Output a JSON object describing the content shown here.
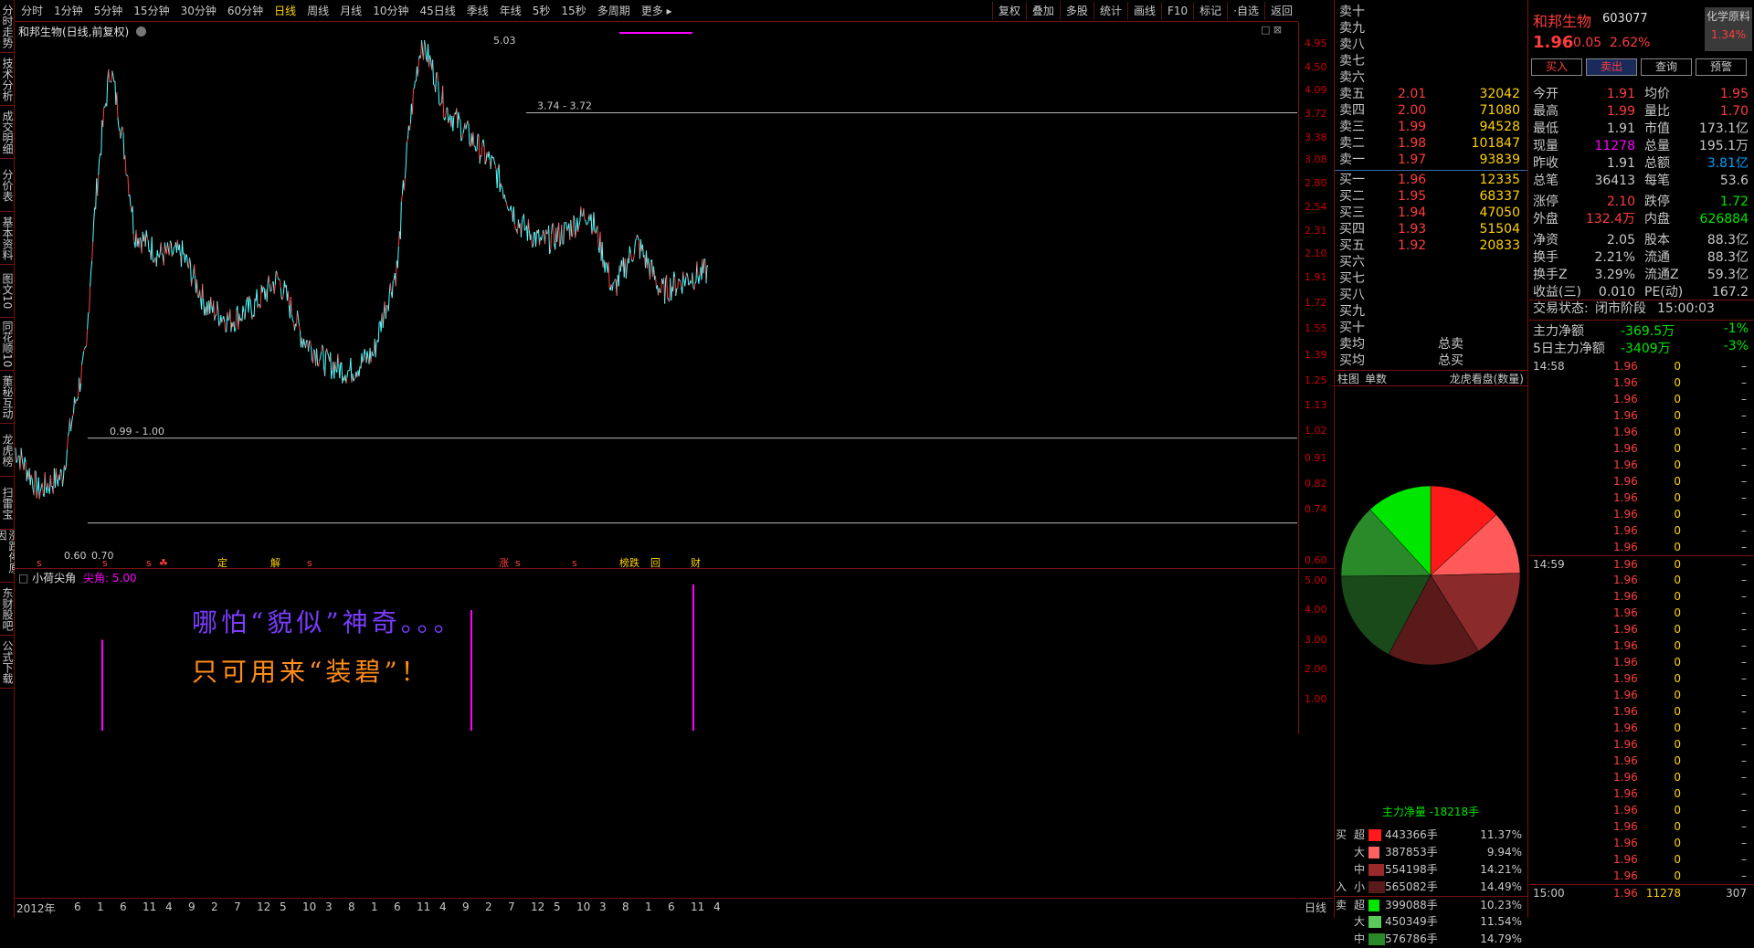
{
  "side_tabs": [
    "分时走势",
    "技术分析",
    "成交明细",
    "分价表",
    "基本资料",
    "图文10",
    "同花顺10",
    "董秘互动",
    "龙虎榜",
    "扫雷宝",
    "涨跌停原因",
    "东财股吧",
    "公式下载"
  ],
  "periods": [
    "分时",
    "1分钟",
    "5分钟",
    "15分钟",
    "30分钟",
    "60分钟",
    "日线",
    "周线",
    "月线",
    "10分钟",
    "45日线",
    "季线",
    "年线",
    "5秒",
    "15秒",
    "多周期",
    "更多 ▸"
  ],
  "active_period": "日线",
  "tools": [
    "复权",
    "叠加",
    "多股",
    "统计",
    "画线",
    "F10",
    "标记",
    "·自选",
    "返回"
  ],
  "chart_title": "和邦生物(日线,前复权)",
  "price_axis": [
    "4.95",
    "4.50",
    "4.09",
    "3.72",
    "3.38",
    "3.08",
    "2.80",
    "2.54",
    "2.31",
    "2.10",
    "1.91",
    "1.72",
    "1.55",
    "1.39",
    "1.25",
    "1.13",
    "1.02",
    "0.91",
    "0.82",
    "0.74",
    "0.60"
  ],
  "annotations": {
    "high": "5.03",
    "hline1": "3.74 - 3.72",
    "hline2": "0.99 - 1.00",
    "low": "0.60",
    "low2": "0.70"
  },
  "event_markers": [
    "s",
    "s",
    "s",
    "☘",
    "定",
    "解",
    "s",
    "涨",
    "s",
    "s",
    "榜跌",
    "回",
    "财"
  ],
  "indicator": {
    "name": "小荷尖角",
    "label": "尖角: 5.00",
    "axis": [
      "5.00",
      "4.00",
      "3.00",
      "2.00",
      "1.00"
    ]
  },
  "overlay_text": {
    "line1": "哪怕“貌似”神奇。。。",
    "line2": "只可用来“装碧”！"
  },
  "date_axis": [
    "2012年",
    "6",
    "1",
    "6",
    "11",
    "4",
    "9",
    "2",
    "7",
    "12",
    "5",
    "10",
    "3",
    "8",
    "1",
    "6",
    "11",
    "4",
    "9",
    "2",
    "7",
    "12",
    "5",
    "10",
    "3",
    "8",
    "1",
    "6",
    "11",
    "4"
  ],
  "period_label": "日线",
  "order_book": {
    "sells": [
      {
        "l": "卖十",
        "p": "",
        "v": ""
      },
      {
        "l": "卖九",
        "p": "",
        "v": ""
      },
      {
        "l": "卖八",
        "p": "",
        "v": ""
      },
      {
        "l": "卖七",
        "p": "",
        "v": ""
      },
      {
        "l": "卖六",
        "p": "",
        "v": ""
      },
      {
        "l": "卖五",
        "p": "2.01",
        "v": "32042"
      },
      {
        "l": "卖四",
        "p": "2.00",
        "v": "71080"
      },
      {
        "l": "卖三",
        "p": "1.99",
        "v": "94528"
      },
      {
        "l": "卖二",
        "p": "1.98",
        "v": "101847"
      },
      {
        "l": "卖一",
        "p": "1.97",
        "v": "93839"
      }
    ],
    "buys": [
      {
        "l": "买一",
        "p": "1.96",
        "v": "12335"
      },
      {
        "l": "买二",
        "p": "1.95",
        "v": "68337"
      },
      {
        "l": "买三",
        "p": "1.94",
        "v": "47050"
      },
      {
        "l": "买四",
        "p": "1.93",
        "v": "51504"
      },
      {
        "l": "买五",
        "p": "1.92",
        "v": "20833"
      },
      {
        "l": "买六",
        "p": "",
        "v": ""
      },
      {
        "l": "买七",
        "p": "",
        "v": ""
      },
      {
        "l": "买八",
        "p": "",
        "v": ""
      },
      {
        "l": "买九",
        "p": "",
        "v": ""
      },
      {
        "l": "买十",
        "p": "",
        "v": ""
      }
    ],
    "avg_sell": "卖均",
    "total_sell": "总卖",
    "avg_buy": "买均",
    "total_buy": "总买"
  },
  "flow_tabs": [
    "柱图",
    "单数",
    "龙虎看盘(数量)"
  ],
  "pie": {
    "values": [
      11.37,
      9.94,
      14.21,
      14.49,
      14.79,
      11.54,
      10.23
    ],
    "colors": [
      "#ff1a1a",
      "#ff5a5a",
      "#8b2a2a",
      "#5a1a1a",
      "#1a4a1a",
      "#2a8a2a",
      "#5ac85a",
      "#00e600"
    ]
  },
  "pie_values": {
    "buy": [
      11.37,
      9.94,
      14.21,
      14.49
    ],
    "sell": [
      10.23,
      11.54,
      14.79
    ]
  },
  "net_flow": "主力净量 -18218手",
  "flow_rows": [
    {
      "side": "买",
      "size": "超",
      "vol": "443366手",
      "pct": "11.37%",
      "color": "#ff1a1a",
      "frac": 0.77
    },
    {
      "side": "",
      "size": "大",
      "vol": "387853手",
      "pct": "9.94%",
      "color": "#ff6060",
      "frac": 0.67
    },
    {
      "side": "",
      "size": "中",
      "vol": "554198手",
      "pct": "14.21%",
      "color": "#9a2a2a",
      "frac": 0.96
    },
    {
      "side": "入",
      "size": "小",
      "vol": "565082手",
      "pct": "14.49%",
      "color": "#5a1a1a",
      "frac": 0.98
    },
    {
      "side": "卖",
      "size": "超",
      "vol": "399088手",
      "pct": "10.23%",
      "color": "#00e600",
      "frac": 0.69
    },
    {
      "side": "",
      "size": "大",
      "vol": "450349手",
      "pct": "11.54%",
      "color": "#5ac85a",
      "frac": 0.78
    },
    {
      "side": "",
      "size": "中",
      "vol": "576786手",
      "pct": "14.79%",
      "color": "#2a8a2a",
      "frac": 1.0
    }
  ],
  "quote": {
    "name": "和邦生物",
    "code": "603077",
    "sector": "化学原料",
    "sector_pct": "1.34%",
    "price": "1.96",
    "change": "0.05",
    "pct": "2.62%",
    "buttons": [
      "买入",
      "卖出",
      "查询",
      "预警"
    ],
    "rows": [
      [
        "今开",
        "1.91",
        "均价",
        "1.95"
      ],
      [
        "最高",
        "1.99",
        "量比",
        "1.70"
      ],
      [
        "最低",
        "1.91",
        "市值",
        "173.1亿"
      ],
      [
        "现量",
        "11278",
        "总量",
        "195.1万"
      ],
      [
        "昨收",
        "1.91",
        "总额",
        "3.81亿"
      ],
      [
        "总笔",
        "36413",
        "每笔",
        "53.6"
      ],
      [
        "涨停",
        "2.10",
        "跌停",
        "1.72"
      ],
      [
        "外盘",
        "132.4万",
        "内盘",
        "626884"
      ],
      [
        "净资",
        "2.05",
        "股本",
        "88.3亿"
      ],
      [
        "换手",
        "2.21%",
        "流通",
        "88.3亿"
      ],
      [
        "换手Z",
        "3.29%",
        "流通Z",
        "59.3亿"
      ],
      [
        "收益(三)",
        "0.010",
        "PE(动)",
        "167.2"
      ]
    ],
    "status_label": "交易状态:",
    "status": "闭市阶段",
    "time": "15:00:03",
    "main_net_label": "主力净额",
    "main_net": "-369.5万",
    "main_net_pct": "-1%",
    "main5_label": "5日主力净额",
    "main5": "-3409万",
    "main5_pct": "-3%"
  },
  "ticks": [
    {
      "t": "14:58",
      "p": "1.96",
      "v": "0",
      "d": "–"
    },
    {
      "t": "",
      "p": "1.96",
      "v": "0",
      "d": "–"
    },
    {
      "t": "",
      "p": "1.96",
      "v": "0",
      "d": "–"
    },
    {
      "t": "",
      "p": "1.96",
      "v": "0",
      "d": "–"
    },
    {
      "t": "",
      "p": "1.96",
      "v": "0",
      "d": "–"
    },
    {
      "t": "",
      "p": "1.96",
      "v": "0",
      "d": "–"
    },
    {
      "t": "",
      "p": "1.96",
      "v": "0",
      "d": "–"
    },
    {
      "t": "",
      "p": "1.96",
      "v": "0",
      "d": "–"
    },
    {
      "t": "",
      "p": "1.96",
      "v": "0",
      "d": "–"
    },
    {
      "t": "",
      "p": "1.96",
      "v": "0",
      "d": "–"
    },
    {
      "t": "",
      "p": "1.96",
      "v": "0",
      "d": "–"
    },
    {
      "t": "",
      "p": "1.96",
      "v": "0",
      "d": "–"
    },
    {
      "t": "14:59",
      "p": "1.96",
      "v": "0",
      "d": "–"
    },
    {
      "t": "",
      "p": "1.96",
      "v": "0",
      "d": "–"
    },
    {
      "t": "",
      "p": "1.96",
      "v": "0",
      "d": "–"
    },
    {
      "t": "",
      "p": "1.96",
      "v": "0",
      "d": "–"
    },
    {
      "t": "",
      "p": "1.96",
      "v": "0",
      "d": "–"
    },
    {
      "t": "",
      "p": "1.96",
      "v": "0",
      "d": "–"
    },
    {
      "t": "",
      "p": "1.96",
      "v": "0",
      "d": "–"
    },
    {
      "t": "",
      "p": "1.96",
      "v": "0",
      "d": "–"
    },
    {
      "t": "",
      "p": "1.96",
      "v": "0",
      "d": "–"
    },
    {
      "t": "",
      "p": "1.96",
      "v": "0",
      "d": "–"
    },
    {
      "t": "",
      "p": "1.96",
      "v": "0",
      "d": "–"
    },
    {
      "t": "",
      "p": "1.96",
      "v": "0",
      "d": "–"
    },
    {
      "t": "",
      "p": "1.96",
      "v": "0",
      "d": "–"
    },
    {
      "t": "",
      "p": "1.96",
      "v": "0",
      "d": "–"
    },
    {
      "t": "",
      "p": "1.96",
      "v": "0",
      "d": "–"
    },
    {
      "t": "",
      "p": "1.96",
      "v": "0",
      "d": "–"
    },
    {
      "t": "",
      "p": "1.96",
      "v": "0",
      "d": "–"
    },
    {
      "t": "",
      "p": "1.96",
      "v": "0",
      "d": "–"
    },
    {
      "t": "",
      "p": "1.96",
      "v": "0",
      "d": "–"
    },
    {
      "t": "",
      "p": "1.96",
      "v": "0",
      "d": "–"
    },
    {
      "t": "15:00",
      "p": "1.96",
      "v": "11278",
      "d": "307"
    }
  ],
  "chart_data": {
    "type": "line",
    "title": "和邦生物(日线,前复权)",
    "x": [
      "2012-02",
      "2012-08",
      "2013-01",
      "2013-07",
      "2014-01",
      "2014-06",
      "2014-11",
      "2015-04",
      "2015-09",
      "2016-02",
      "2016-07",
      "2016-12",
      "2017-05",
      "2017-10",
      "2018-03",
      "2018-08",
      "2019-01",
      "2019-06",
      "2019-11",
      "2020-04",
      "2020-09",
      "2021-02",
      "2021-07",
      "2021-12",
      "2022-05",
      "2022-10",
      "2023-03",
      "2023-08",
      "2024-01",
      "2024-06"
    ],
    "series": [
      {
        "values": [
          0.95,
          0.8,
          0.85,
          1.4,
          4.5,
          2.3,
          2.1,
          2.1,
          1.7,
          1.6,
          1.7,
          1.9,
          1.5,
          1.35,
          1.3,
          1.4,
          2.0,
          5.03,
          3.8,
          3.4,
          3.0,
          2.4,
          2.2,
          2.3,
          2.5,
          1.8,
          2.2,
          1.8,
          1.9,
          1.96
        ]
      }
    ],
    "ylim": [
      0.6,
      5.03
    ],
    "yscale": "log",
    "markers": [
      {
        "label": "5.03",
        "value": 5.03
      },
      {
        "label": "0.60",
        "value": 0.6
      }
    ],
    "hlines": [
      [
        3.74,
        3.72
      ],
      [
        0.99,
        1.0
      ],
      [
        0.7,
        0.7
      ]
    ],
    "indicator_spikes": [
      3.0,
      4.0,
      5.0
    ],
    "grid": false
  }
}
